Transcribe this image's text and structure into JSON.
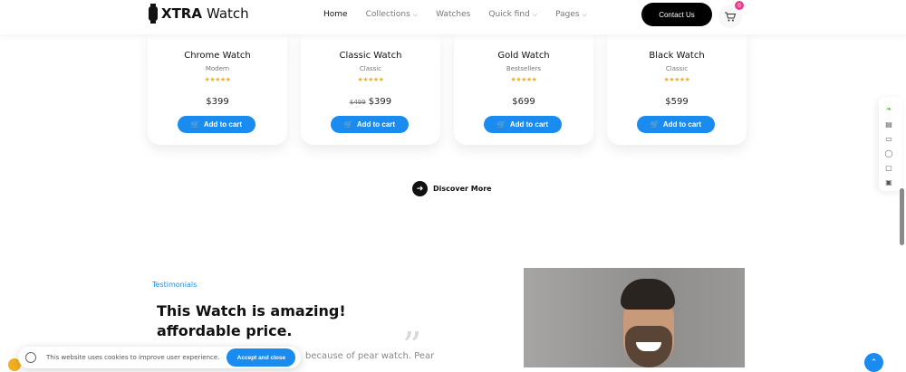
{
  "header": {
    "brand_bold": "XTRA",
    "brand_light": "Watch",
    "nav": [
      {
        "label": "Home",
        "dropdown": false
      },
      {
        "label": "Collections",
        "dropdown": true
      },
      {
        "label": "Watches",
        "dropdown": false
      },
      {
        "label": "Quick find",
        "dropdown": true
      },
      {
        "label": "Pages",
        "dropdown": true
      }
    ],
    "contact_label": "Contact Us",
    "cart_count": "0"
  },
  "products": [
    {
      "name": "Chrome Watch",
      "category": "Modern",
      "stars": "★★★★★",
      "old_price": "",
      "price": "$399",
      "button": "Add to cart"
    },
    {
      "name": "Classic Watch",
      "category": "Classic",
      "stars": "★★★★★",
      "old_price": "$499",
      "price": "$399",
      "button": "Add to cart"
    },
    {
      "name": "Gold Watch",
      "category": "Bestsellers",
      "stars": "★★★★★",
      "old_price": "",
      "price": "$699",
      "button": "Add to cart"
    },
    {
      "name": "Black Watch",
      "category": "Classic",
      "stars": "★★★★★",
      "old_price": "",
      "price": "$599",
      "button": "Add to cart"
    }
  ],
  "discover_label": "Discover More",
  "testimonial": {
    "label": "Testimonials",
    "title_line1": "This Watch is amazing!",
    "title_line2": "affordable price.",
    "quote": "”",
    "text_fragment": "because of pear watch. Pear"
  },
  "cookie": {
    "message": "This website uses cookies to improve user experience.",
    "accept_label": "Accept and close"
  },
  "colors": {
    "accent": "#1a8cf0",
    "star": "#f2b01e",
    "badge": "#e83e8c",
    "dark": "#000000"
  }
}
